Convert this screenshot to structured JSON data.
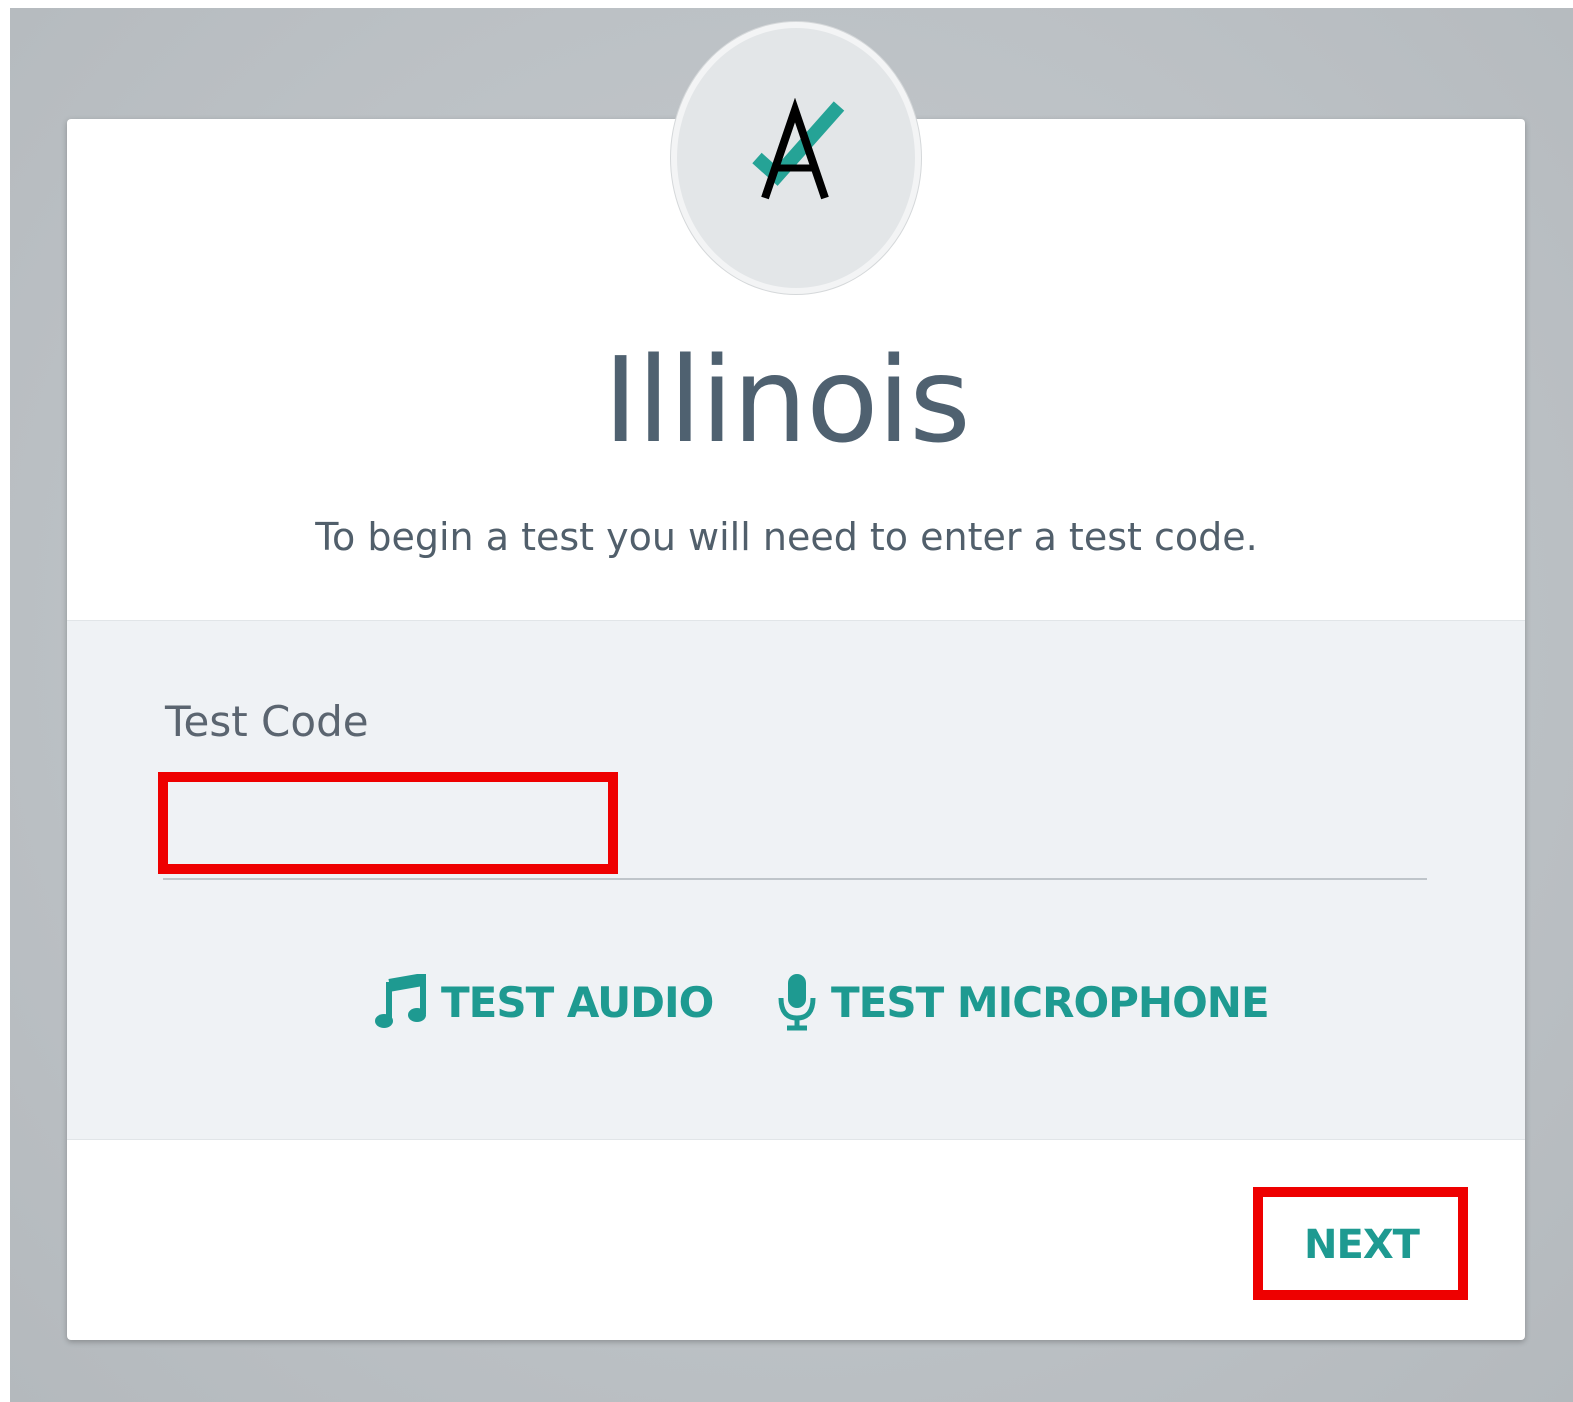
{
  "app": {
    "title": "Illinois",
    "subtitle": "To begin a test you will need to enter a test code."
  },
  "form": {
    "test_code_label": "Test Code",
    "test_code_value": "",
    "test_code_placeholder": ""
  },
  "actions": {
    "test_audio_label": "TEST AUDIO",
    "test_microphone_label": "TEST MICROPHONE",
    "next_label": "NEXT"
  },
  "icons": {
    "logo": "logo-a-check-icon",
    "audio": "music-note-icon",
    "microphone": "microphone-icon"
  },
  "colors": {
    "accent": "#1e9a91",
    "title": "#4f6170",
    "panel_bg": "#eff2f5",
    "highlight": "#ee0000",
    "backdrop": "#bcc1c5"
  }
}
